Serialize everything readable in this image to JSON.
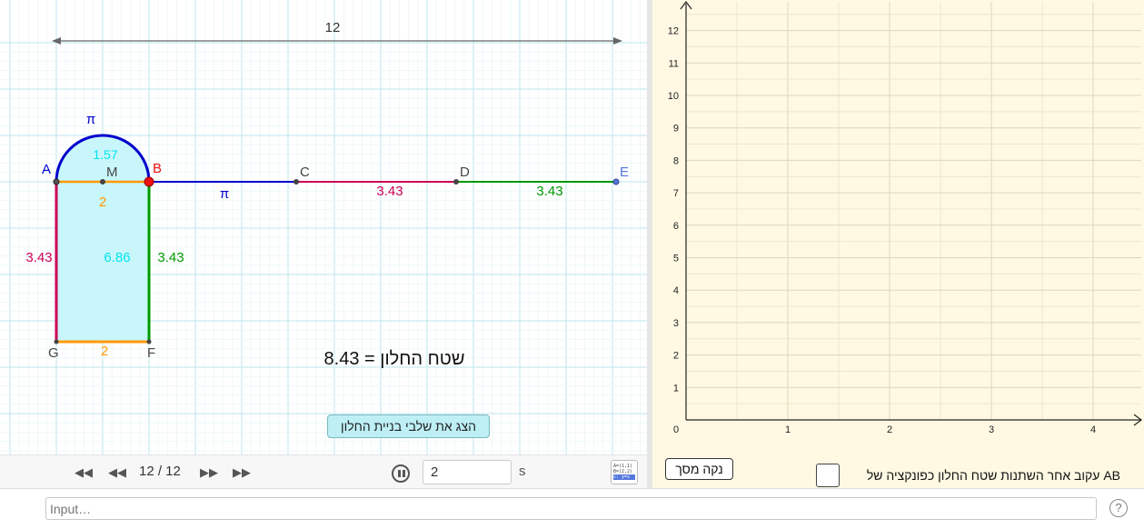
{
  "geometry_view": {
    "width_value": "12",
    "labels": {
      "A": "A",
      "B": "B",
      "C": "C",
      "D": "D",
      "E": "E",
      "F": "F",
      "G": "G",
      "M": "M"
    },
    "arc_length": "π",
    "semicircle_area": "1.57",
    "seg_AB": "2",
    "seg_BC": "π",
    "seg_CD": "3.43",
    "seg_DE": "3.43",
    "left_side": "3.43",
    "right_side": "3.43",
    "rect_area": "6.86",
    "seg_GF": "2",
    "area_label": "שטח החלון = 8.43",
    "show_steps_button": "הצג את שלבי בניית החלון",
    "colors": {
      "blue": "#0000cc",
      "crimson": "#cc0055",
      "green": "#009900",
      "orange": "#ff9900",
      "cyan": "#00e5ee",
      "fill": "#c8f6fa",
      "point_red": "#ee1111",
      "point_e": "#5577dd"
    }
  },
  "graph_view": {
    "x_ticks": [
      "0",
      "1",
      "2",
      "3",
      "4"
    ],
    "y_ticks": [
      "1",
      "2",
      "3",
      "4",
      "5",
      "6",
      "7",
      "8",
      "9",
      "10",
      "11",
      "12"
    ],
    "clear_button": "נקה מסך",
    "trace_label": "AB עקוב אחר השתנות  שטח החלון כפונקציה של"
  },
  "nav": {
    "counter": "12 / 12",
    "speed": "2",
    "speed_unit": "s",
    "algebra_icon_lines": [
      "A=(1,1)",
      "B=(2,2)",
      "c: y=x"
    ]
  },
  "input_bar": {
    "placeholder": "Input…"
  },
  "icons": {
    "first": "first-slide-icon",
    "prev": "previous-slide-icon",
    "next": "next-slide-icon",
    "last": "last-slide-icon",
    "pause": "pause-icon",
    "help": "help-icon"
  }
}
